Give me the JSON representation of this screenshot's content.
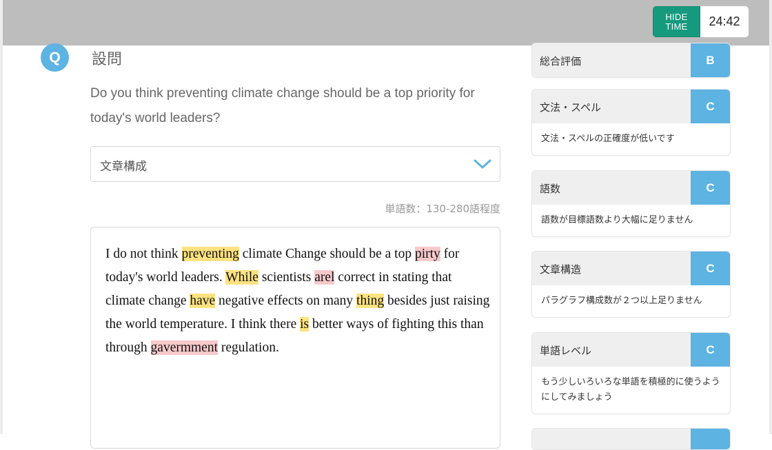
{
  "timer": {
    "hide_line1": "HIDE",
    "hide_line2": "TIME",
    "time": "24:42"
  },
  "question": {
    "badge": "Q",
    "title": "設問",
    "text": "Do you think preventing climate change should be a top priority for today's world leaders?"
  },
  "category_select": {
    "selected": "文章構成"
  },
  "word_count": "単語数：130-280語程度",
  "essay": {
    "segments": [
      {
        "t": "I do not think ",
        "h": ""
      },
      {
        "t": "preventing",
        "h": "yellow"
      },
      {
        "t": " climate Change should be a top ",
        "h": ""
      },
      {
        "t": "pirty",
        "h": "pink"
      },
      {
        "t": " for today's world leaders. ",
        "h": ""
      },
      {
        "t": "While",
        "h": "yellow"
      },
      {
        "t": " scientists ",
        "h": ""
      },
      {
        "t": "arel",
        "h": "pink"
      },
      {
        "t": " correct in stating that climate change ",
        "h": ""
      },
      {
        "t": "have",
        "h": "yellow"
      },
      {
        "t": " negative effects on many ",
        "h": ""
      },
      {
        "t": "thing",
        "h": "yellow"
      },
      {
        "t": " besides just raising the world temperature. I think there ",
        "h": ""
      },
      {
        "t": "is",
        "h": "yellow"
      },
      {
        "t": " better ways of fighting this than through ",
        "h": ""
      },
      {
        "t": "gavermment",
        "h": "pink"
      },
      {
        "t": " regulation.",
        "h": ""
      }
    ]
  },
  "colors": {
    "accent_blue": "#5db3e2",
    "timer_green": "#159a7e",
    "highlight_yellow": "#fde27f",
    "highlight_pink": "#f7c9cb"
  },
  "evaluation": {
    "overall": {
      "label": "総合評価",
      "grade": "B"
    },
    "items": [
      {
        "label": "文法・スペル",
        "grade": "C",
        "comment": "文法・スペルの正確度が低いです"
      },
      {
        "label": "語数",
        "grade": "C",
        "comment": "語数が目標語数より大幅に足りません"
      },
      {
        "label": "文章構造",
        "grade": "C",
        "comment": "パラグラフ構成数が２つ以上足りません"
      },
      {
        "label": "単語レベル",
        "grade": "C",
        "comment": "もう少しいろいろな単語を積極的に使うようにしてみましょう"
      }
    ]
  }
}
